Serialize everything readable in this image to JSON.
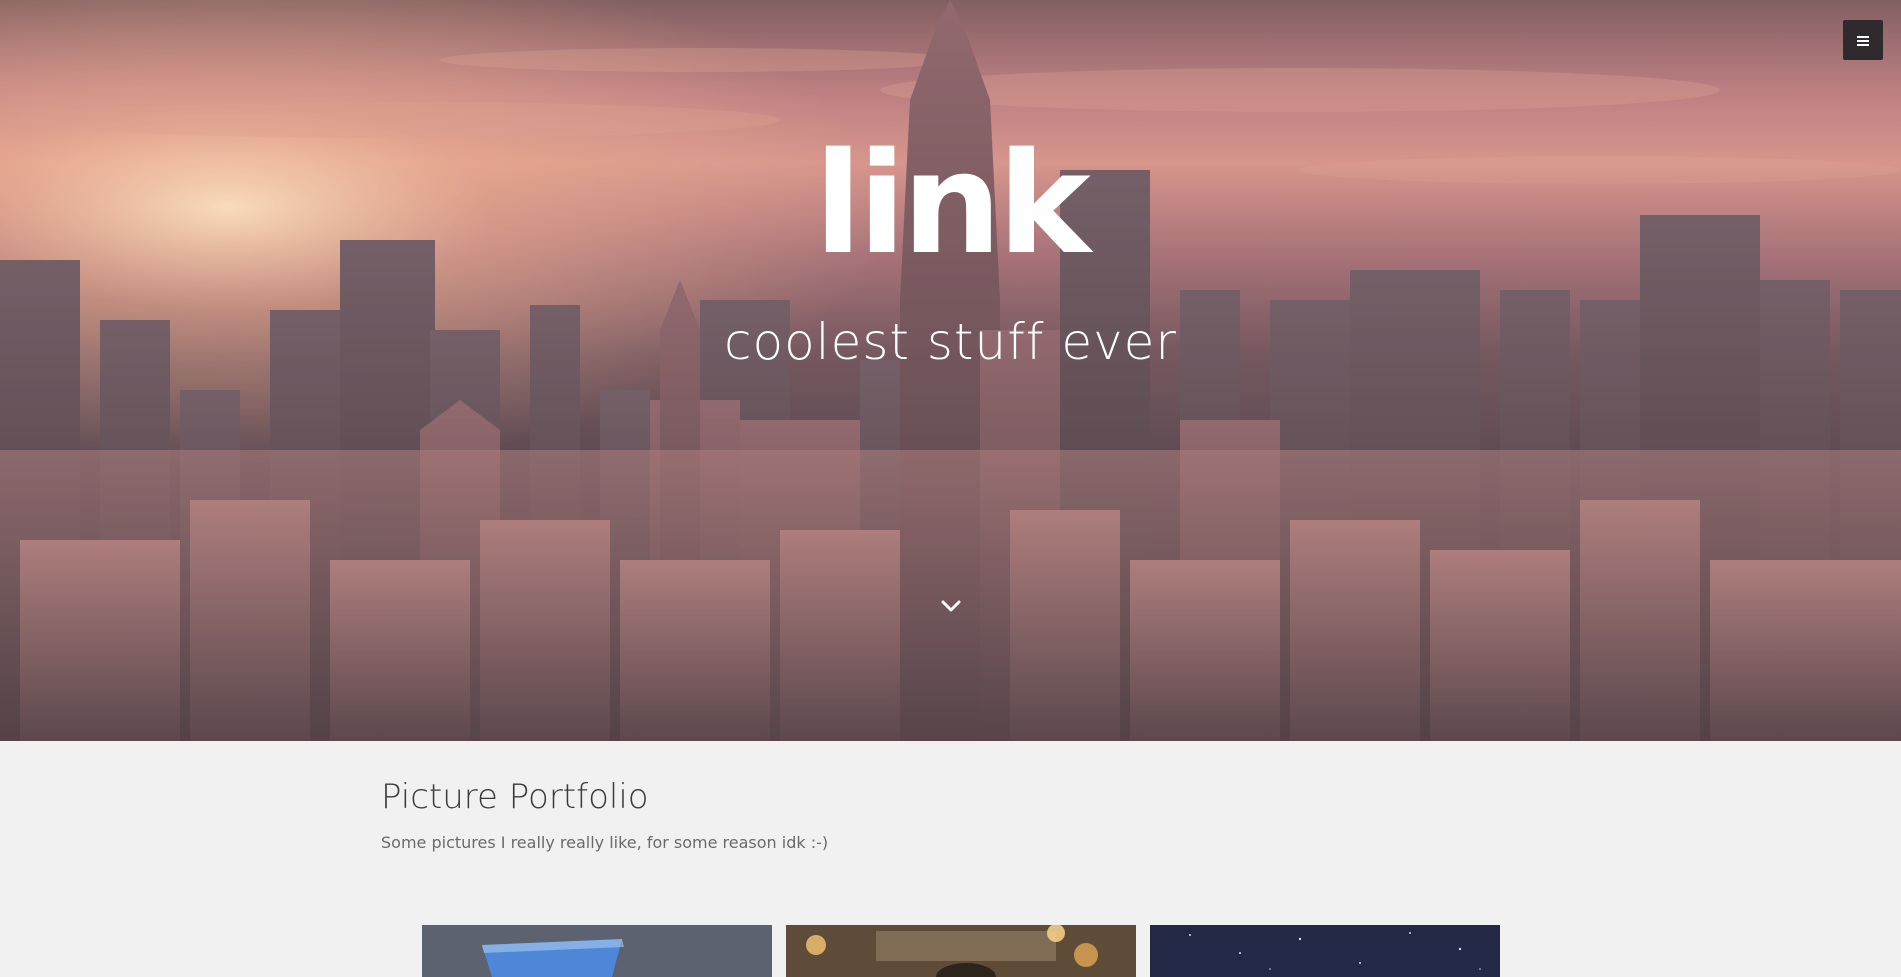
{
  "hero": {
    "title": "link",
    "subtitle": "coolest stuff ever",
    "menu_icon": "hamburger-menu-icon",
    "scroll_icon": "chevron-down-icon"
  },
  "portfolio": {
    "title": "Picture Portfolio",
    "subtitle": "Some pictures I really really like, for some reason idk :-)",
    "thumbnails": [
      {
        "subject": "blue-screen-photo"
      },
      {
        "subject": "warm-lights-photo"
      },
      {
        "subject": "night-sky-photo"
      }
    ]
  },
  "colors": {
    "background": "#f2f1f1",
    "hero_text": "#ffffff",
    "menu_button_bg": "#2e2a2e",
    "section_title": "#3b3b3b",
    "section_subtitle": "#6a6a6a"
  }
}
